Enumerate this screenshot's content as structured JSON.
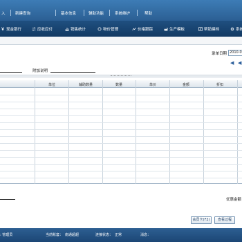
{
  "menu": {
    "items": [
      "入",
      "新建查询",
      "基本信息",
      "辅助功能",
      "系统维护",
      "帮助"
    ]
  },
  "toolbar": {
    "items": [
      {
        "label": "现金银行",
        "icon": "yen-icon"
      },
      {
        "label": "应收应付",
        "icon": "exchange-icon"
      },
      {
        "label": "销售统计",
        "icon": "chart-icon"
      },
      {
        "label": "物价管理",
        "icon": "tag-icon"
      },
      {
        "label": "价格跟踪",
        "icon": "trend-icon"
      },
      {
        "label": "生产模板",
        "icon": "factory-icon"
      },
      {
        "label": "帮助建档",
        "icon": "edit-icon"
      },
      {
        "label": "系统",
        "icon": "gear-icon"
      }
    ]
  },
  "form": {
    "record_date_label": "录单日期",
    "record_date_value": "2010-0",
    "extra_note_label": "附加说明"
  },
  "grid": {
    "columns": [
      "单位",
      "辅助数量",
      "数量",
      "单价",
      "金额",
      "折扣"
    ]
  },
  "footer": {
    "discount_amount_label": "优惠金额"
  },
  "buttons": {
    "member_card": "会员卡(F2)",
    "view_process": "查看过程"
  },
  "status": {
    "user": ": 管理员",
    "account_label": "当前账套：",
    "account_value": "南通超超",
    "connection_label": "连接状态：",
    "connection_value": "正常",
    "message_label": "消息："
  },
  "colors": {
    "menubar": "#3d7cb6",
    "toolbar": "#1f4f80",
    "statusbar": "#2d5f92"
  }
}
